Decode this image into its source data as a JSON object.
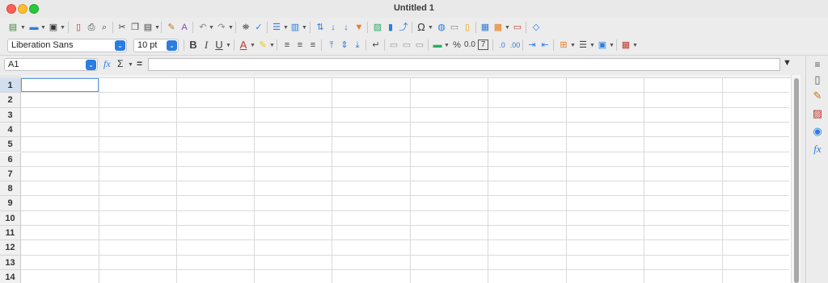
{
  "window": {
    "title": "Untitled 1"
  },
  "toolbar": {
    "font_name": "Liberation Sans",
    "font_size": "10 pt",
    "percent_label": "%",
    "decimal_label": "0.0"
  },
  "formula_bar": {
    "cell_ref": "A1",
    "function_label": "fx",
    "sum_label": "Σ",
    "equals_label": "=",
    "content": ""
  },
  "sheet": {
    "rows": [
      "1",
      "2",
      "3",
      "4",
      "5",
      "6",
      "7",
      "8",
      "9",
      "10",
      "11",
      "12",
      "13",
      "14"
    ],
    "active_cell": "A1"
  },
  "colors": {
    "accent": "#2b7de0",
    "cursor": "#5e9ce6",
    "active_header": "#d2dff0"
  },
  "sidebar": {
    "icons": [
      "hamburger-icon",
      "properties-icon",
      "styles-icon",
      "gallery-icon",
      "navigator-icon",
      "functions-icon"
    ],
    "functions_label": "fx"
  }
}
